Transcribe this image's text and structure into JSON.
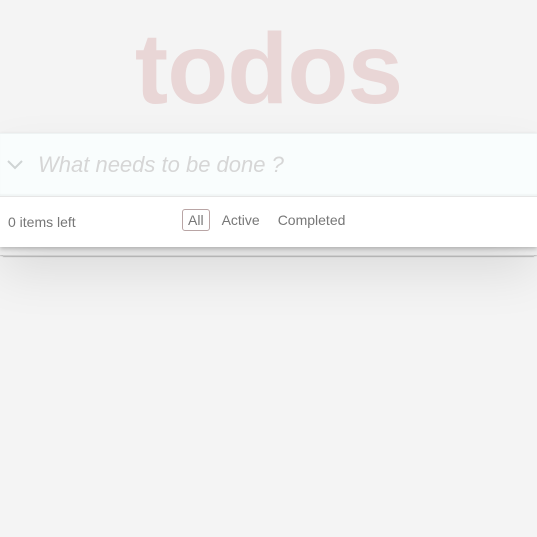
{
  "app": {
    "title": "todos"
  },
  "header": {
    "new_todo_placeholder": "What needs to be done ?",
    "toggle_all_icon": "chevron-down-icon"
  },
  "footer": {
    "items_left": "0 items left",
    "filters": [
      {
        "label": "All",
        "selected": true
      },
      {
        "label": "Active",
        "selected": false
      },
      {
        "label": "Completed",
        "selected": false
      }
    ]
  },
  "colors": {
    "title": "#e8d7d7",
    "background": "#f4f4f4",
    "input_bg": "#f9fdfd",
    "placeholder": "#d6d6d6",
    "footer_text": "#777777",
    "selected_filter_border": "#b9a5a5"
  }
}
